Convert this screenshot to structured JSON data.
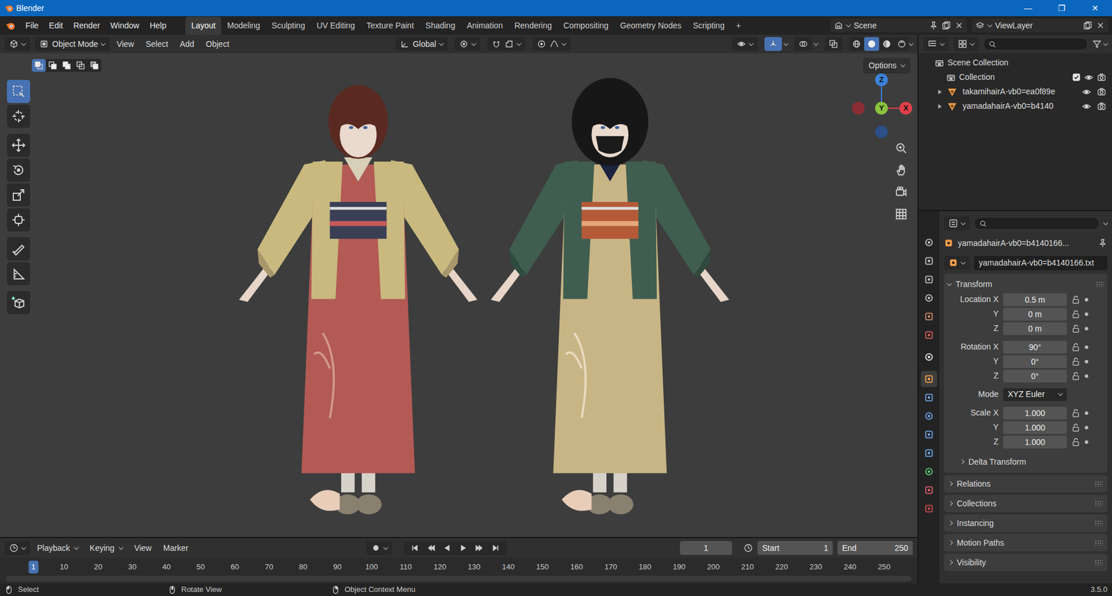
{
  "window": {
    "title": "Blender",
    "controls": [
      "—",
      "❐",
      "✕"
    ]
  },
  "menu": [
    "File",
    "Edit",
    "Render",
    "Window",
    "Help"
  ],
  "workspaces": [
    {
      "label": "Layout",
      "selected": true
    },
    {
      "label": "Modeling",
      "selected": false
    },
    {
      "label": "Sculpting",
      "selected": false
    },
    {
      "label": "UV Editing",
      "selected": false
    },
    {
      "label": "Texture Paint",
      "selected": false
    },
    {
      "label": "Shading",
      "selected": false
    },
    {
      "label": "Animation",
      "selected": false
    },
    {
      "label": "Rendering",
      "selected": false
    },
    {
      "label": "Compositing",
      "selected": false
    },
    {
      "label": "Geometry Nodes",
      "selected": false
    },
    {
      "label": "Scripting",
      "selected": false
    }
  ],
  "add_workspace": "+",
  "scene": "Scene",
  "view_layer": "ViewLayer",
  "viewport": {
    "mode": "Object Mode",
    "menus": [
      "View",
      "Select",
      "Add",
      "Object"
    ],
    "orientation": "Global",
    "options": "Options",
    "select_modes": [
      {
        "selected": true
      },
      {
        "selected": false
      },
      {
        "selected": false
      },
      {
        "selected": false
      },
      {
        "selected": false
      }
    ],
    "gizmo_toggle": {
      "on": true
    },
    "shading": [
      {
        "selected": false
      },
      {
        "selected": true
      },
      {
        "selected": false
      },
      {
        "selected": false
      }
    ],
    "axes": {
      "z": "Z",
      "x": "X",
      "y": "Y"
    },
    "tools": [
      {
        "selected": true
      },
      {
        "selected": false
      },
      {
        "selected": false
      },
      {
        "selected": false
      },
      {
        "selected": false
      },
      {
        "selected": false
      },
      {
        "selected": false
      },
      {
        "selected": false
      },
      {
        "selected": false
      }
    ]
  },
  "timeline": {
    "menus": [
      {
        "label": "Playback",
        "kind": "dropdown"
      },
      {
        "label": "Keying",
        "kind": "dropdown"
      },
      {
        "label": "View",
        "kind": "menu"
      },
      {
        "label": "Marker",
        "kind": "menu"
      }
    ],
    "current_frame": "1",
    "start_label": "Start",
    "start": "1",
    "end_label": "End",
    "end": "250",
    "ruler": [
      {
        "label": "1",
        "selected": true
      },
      {
        "label": "10",
        "selected": false
      },
      {
        "label": "20",
        "selected": false
      },
      {
        "label": "30",
        "selected": false
      },
      {
        "label": "40",
        "selected": false
      },
      {
        "label": "50",
        "selected": false
      },
      {
        "label": "60",
        "selected": false
      },
      {
        "label": "70",
        "selected": false
      },
      {
        "label": "80",
        "selected": false
      },
      {
        "label": "90",
        "selected": false
      },
      {
        "label": "100",
        "selected": false
      },
      {
        "label": "110",
        "selected": false
      },
      {
        "label": "120",
        "selected": false
      },
      {
        "label": "130",
        "selected": false
      },
      {
        "label": "140",
        "selected": false
      },
      {
        "label": "150",
        "selected": false
      },
      {
        "label": "160",
        "selected": false
      },
      {
        "label": "170",
        "selected": false
      },
      {
        "label": "180",
        "selected": false
      },
      {
        "label": "190",
        "selected": false
      },
      {
        "label": "200",
        "selected": false
      },
      {
        "label": "210",
        "selected": false
      },
      {
        "label": "220",
        "selected": false
      },
      {
        "label": "230",
        "selected": false
      },
      {
        "label": "240",
        "selected": false
      },
      {
        "label": "250",
        "selected": false
      }
    ]
  },
  "outliner": {
    "items": [
      {
        "label": "Scene Collection",
        "kind": "scene"
      },
      {
        "label": "Collection",
        "kind": "collection",
        "checked": true,
        "visible": true,
        "renderable": true
      },
      {
        "label": "takamihairA-vb0=ea0f89e",
        "kind": "object",
        "expanded": false,
        "visible": true,
        "renderable": true
      },
      {
        "label": "yamadahairA-vb0=b4140",
        "kind": "object",
        "expanded": false,
        "visible": true,
        "renderable": true
      }
    ]
  },
  "properties": {
    "tabs": [
      {
        "selected": false
      },
      {
        "selected": false
      },
      {
        "selected": false
      },
      {
        "selected": false
      },
      {
        "selected": false
      },
      {
        "selected": false
      },
      {
        "selected": false
      },
      {
        "selected": true
      },
      {
        "selected": false
      },
      {
        "selected": false
      },
      {
        "selected": false
      },
      {
        "selected": false
      },
      {
        "selected": false
      },
      {
        "selected": false
      },
      {
        "selected": false
      }
    ],
    "object_name": "yamadahairA-vb0=b4140166...",
    "data_name": "yamadahairA-vb0=b4140166.txt",
    "transform": {
      "label": "Transform",
      "expanded": true,
      "groups": [
        {
          "rows": [
            {
              "label": "Location X",
              "value": "0.5 m",
              "kind": "number",
              "locked": false
            },
            {
              "label": "Y",
              "value": "0 m",
              "kind": "number",
              "locked": false
            },
            {
              "label": "Z",
              "value": "0 m",
              "kind": "number",
              "locked": false
            }
          ]
        },
        {
          "rows": [
            {
              "label": "Rotation X",
              "value": "90°",
              "kind": "number",
              "locked": false
            },
            {
              "label": "Y",
              "value": "0°",
              "kind": "number",
              "locked": false
            },
            {
              "label": "Z",
              "value": "0°",
              "kind": "number",
              "locked": false
            }
          ]
        },
        {
          "rows": [
            {
              "label": "Mode",
              "value": "XYZ Euler",
              "kind": "dropdown"
            }
          ]
        },
        {
          "rows": [
            {
              "label": "Scale X",
              "value": "1.000",
              "kind": "number",
              "locked": false
            },
            {
              "label": "Y",
              "value": "1.000",
              "kind": "number",
              "locked": false
            },
            {
              "label": "Z",
              "value": "1.000",
              "kind": "number",
              "locked": false
            }
          ]
        }
      ],
      "subpanels": [
        {
          "label": "Delta Transform",
          "expanded": false
        }
      ]
    },
    "panels": [
      {
        "label": "Relations",
        "expanded": false
      },
      {
        "label": "Collections",
        "expanded": false
      },
      {
        "label": "Instancing",
        "expanded": false
      },
      {
        "label": "Motion Paths",
        "expanded": false
      },
      {
        "label": "Visibility",
        "expanded": false
      }
    ]
  },
  "status_bar": {
    "items": [
      "Select",
      "Rotate View",
      "Object Context Menu"
    ],
    "version": "3.5.0"
  }
}
